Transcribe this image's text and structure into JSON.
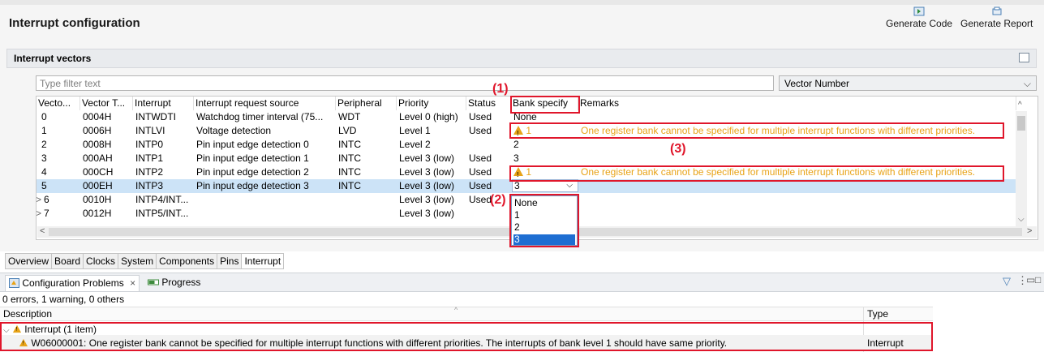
{
  "editor": {
    "title": "Interrupt configuration",
    "generate_code": "Generate Code",
    "generate_report": "Generate Report"
  },
  "section": {
    "title": "Interrupt vectors",
    "filter_placeholder": "Type filter text",
    "vector_select": "Vector Number"
  },
  "table": {
    "headers": [
      "Vecto...",
      "Vector T...",
      "Interrupt",
      "Interrupt request source",
      "Peripheral",
      "Priority",
      "Status",
      "Bank specify",
      "Remarks"
    ],
    "rows": [
      {
        "expand": "",
        "num": "0",
        "vt": "0004H",
        "int": "INTWDTI",
        "src": "Watchdog timer interval (75...",
        "per": "WDT",
        "pri": "Level 0 (high)",
        "status": "Used",
        "bank": "None",
        "remarks": ""
      },
      {
        "expand": "",
        "num": "1",
        "vt": "0006H",
        "int": "INTLVI",
        "src": "Voltage detection",
        "per": "LVD",
        "pri": "Level 1",
        "status": "Used",
        "bank": "1",
        "remarks": "One register bank cannot be specified for multiple interrupt functions with different priorities."
      },
      {
        "expand": "",
        "num": "2",
        "vt": "0008H",
        "int": "INTP0",
        "src": "Pin input edge detection 0",
        "per": "INTC",
        "pri": "Level 2",
        "status": "",
        "bank": "2",
        "remarks": ""
      },
      {
        "expand": "",
        "num": "3",
        "vt": "000AH",
        "int": "INTP1",
        "src": "Pin input edge detection 1",
        "per": "INTC",
        "pri": "Level 3 (low)",
        "status": "Used",
        "bank": "3",
        "remarks": ""
      },
      {
        "expand": "",
        "num": "4",
        "vt": "000CH",
        "int": "INTP2",
        "src": "Pin input edge detection 2",
        "per": "INTC",
        "pri": "Level 3 (low)",
        "status": "Used",
        "bank": "1",
        "remarks": "One register bank cannot be specified for multiple interrupt functions with different priorities."
      },
      {
        "expand": "",
        "num": "5",
        "vt": "000EH",
        "int": "INTP3",
        "src": "Pin input edge detection 3",
        "per": "INTC",
        "pri": "Level 3 (low)",
        "status": "Used",
        "bank": "3",
        "remarks": ""
      },
      {
        "expand": ">",
        "num": "6",
        "vt": "0010H",
        "int": "INTP4/INT...",
        "src": "",
        "per": "",
        "pri": "Level 3 (low)",
        "status": "Used",
        "bank": "",
        "remarks": ""
      },
      {
        "expand": ">",
        "num": "7",
        "vt": "0012H",
        "int": "INTP5/INT...",
        "src": "",
        "per": "",
        "pri": "Level 3 (low)",
        "status": "",
        "bank": "",
        "remarks": ""
      }
    ]
  },
  "dropdown": {
    "options": [
      "None",
      "1",
      "2",
      "3"
    ],
    "selected": "3"
  },
  "annotations": {
    "m1": "(1)",
    "m2": "(2)",
    "m3": "(3)"
  },
  "page_tabs": [
    "Overview",
    "Board",
    "Clocks",
    "System",
    "Components",
    "Pins",
    "Interrupt"
  ],
  "problems": {
    "tab_label": "Configuration Problems",
    "tab_close": "×",
    "progress_label": "Progress",
    "summary": "0 errors, 1 warning, 0 others",
    "col_description": "Description",
    "col_type": "Type",
    "group_label": "Interrupt (1 item)",
    "item_text": "W06000001: One register bank cannot be specified for multiple interrupt functions with different priorities. The interrupts of bank level 1 should have same priority.",
    "item_type": "Interrupt"
  },
  "colors": {
    "warning": "#e8a317",
    "annotation": "#e0162b",
    "selection": "#cce3f7",
    "dropdown_selected": "#1e6ed2"
  }
}
